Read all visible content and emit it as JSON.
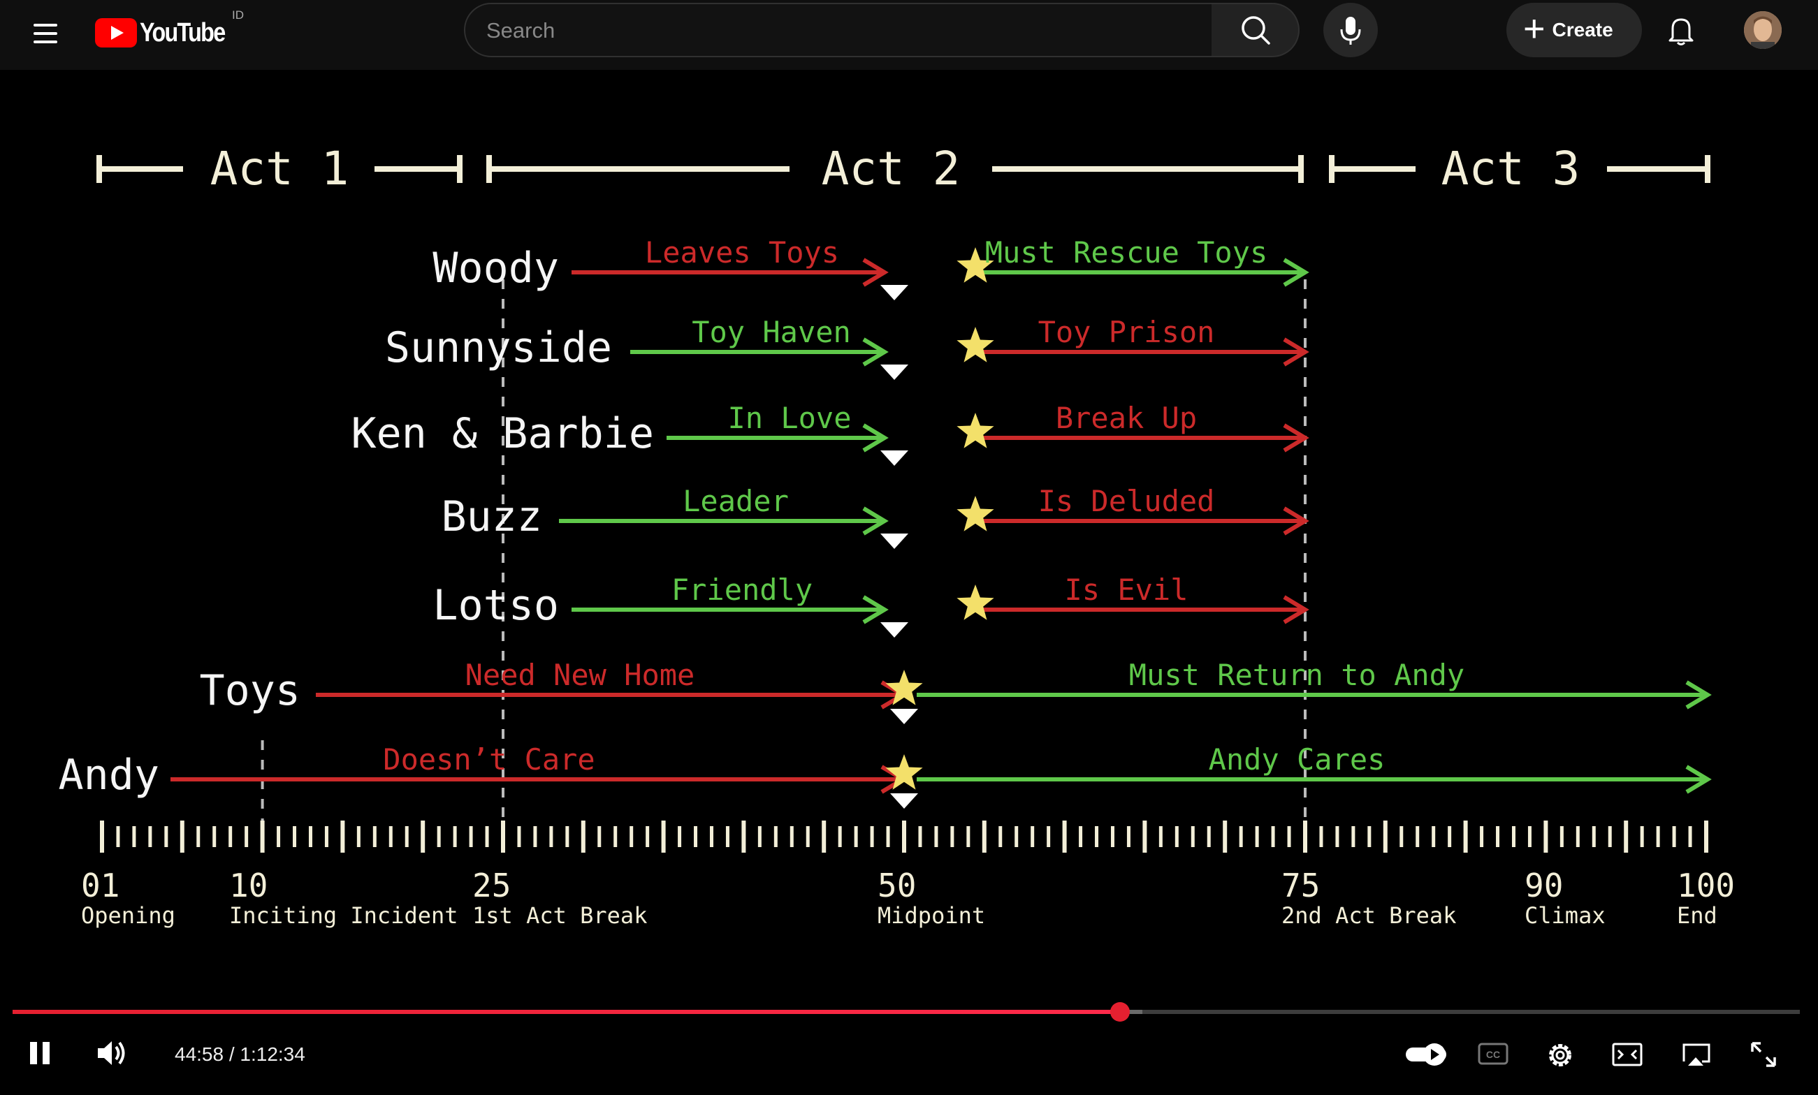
{
  "header": {
    "logo_text": "YouTube",
    "country_code": "ID",
    "search_placeholder": "Search",
    "create_label": "Create"
  },
  "diagram": {
    "acts": [
      "Act 1",
      "Act 2",
      "Act 3"
    ],
    "rows": [
      {
        "label": "Woody",
        "first_phase": "Leaves Toys",
        "first_color": "red",
        "second_phase": "Must Rescue Toys",
        "second_color": "green"
      },
      {
        "label": "Sunnyside",
        "first_phase": "Toy Haven",
        "first_color": "green",
        "second_phase": "Toy Prison",
        "second_color": "red"
      },
      {
        "label": "Ken & Barbie",
        "first_phase": "In Love",
        "first_color": "green",
        "second_phase": "Break Up",
        "second_color": "red"
      },
      {
        "label": "Buzz",
        "first_phase": "Leader",
        "first_color": "green",
        "second_phase": "Is Deluded",
        "second_color": "red"
      },
      {
        "label": "Lotso",
        "first_phase": "Friendly",
        "first_color": "green",
        "second_phase": "Is Evil",
        "second_color": "red"
      },
      {
        "label": "Toys",
        "first_phase": "Need New Home",
        "first_color": "red",
        "second_phase": "Must Return to Andy",
        "second_color": "green"
      },
      {
        "label": "Andy",
        "first_phase": "Doesn’t Care",
        "first_color": "red",
        "second_phase": "Andy Cares",
        "second_color": "green"
      }
    ],
    "timeline_marks": [
      {
        "value": "01",
        "label": "Opening"
      },
      {
        "value": "10",
        "label": "Inciting Incident"
      },
      {
        "value": "25",
        "label": "1st Act Break"
      },
      {
        "value": "50",
        "label": "Midpoint"
      },
      {
        "value": "75",
        "label": "2nd Act Break"
      },
      {
        "value": "90",
        "label": "Climax"
      },
      {
        "value": "100",
        "label": "End"
      }
    ],
    "colors": {
      "red": "#cc2a2a",
      "green": "#5fc84a",
      "star": "#f3e06a",
      "cream": "#f3efd8"
    }
  },
  "player": {
    "time_current": "44:58",
    "time_total": "1:12:34",
    "time_display": "44:58 / 1:12:34",
    "progress_fraction": 0.6197,
    "buffered_fraction": 0.632,
    "state": "playing",
    "controls": [
      "pause-icon",
      "volume-icon",
      "autoplay-toggle-icon",
      "captions-icon",
      "settings-icon",
      "miniplayer-icon",
      "cast-icon",
      "fullscreen-icon"
    ]
  }
}
